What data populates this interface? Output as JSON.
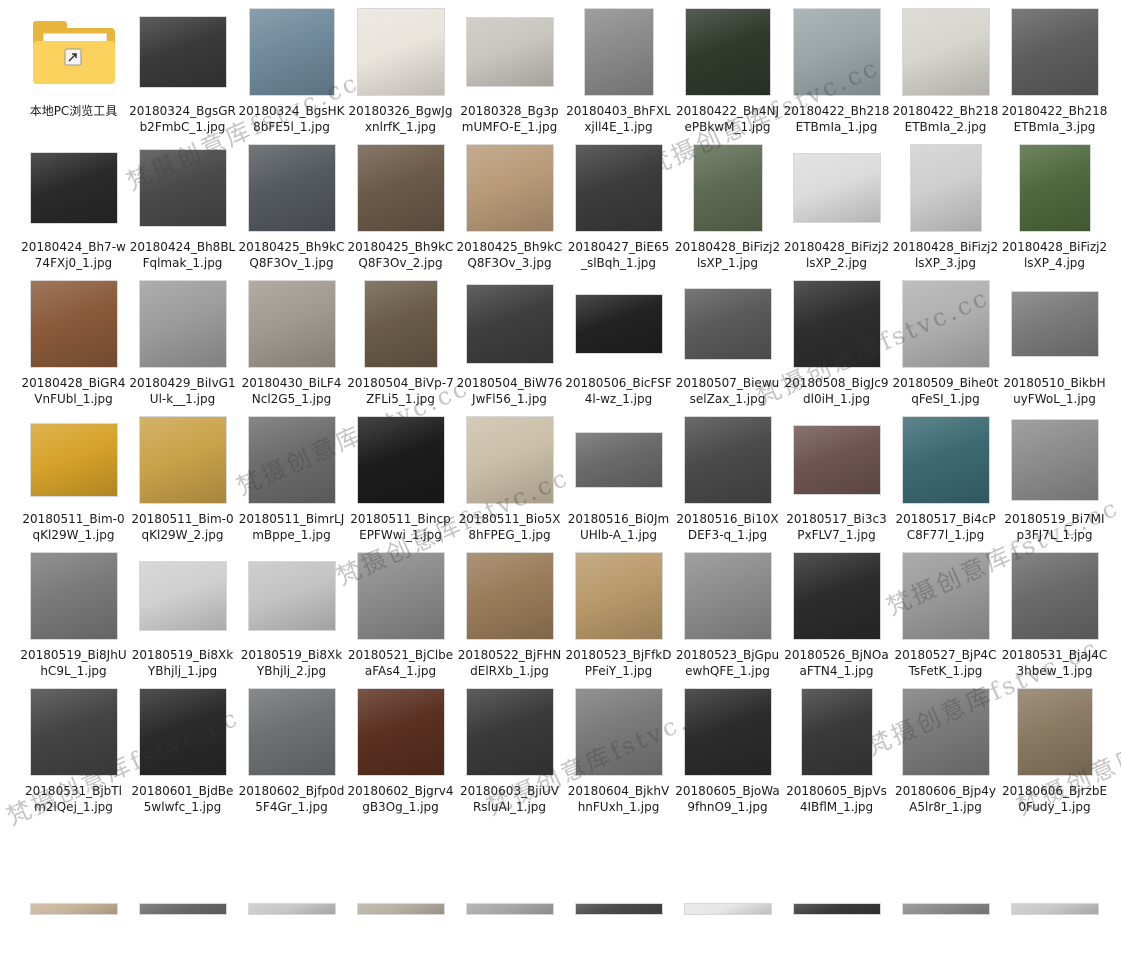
{
  "folder": {
    "label": "本地PC浏览工具",
    "icon": "folder-icon"
  },
  "files": [
    {
      "name": "20180324_BgsGRb2FmbC_1.jpg",
      "tone": "#3a3a3a"
    },
    {
      "name": "20180324_BgsHK8bFE5l_1.jpg",
      "tone": "#6f8a9c"
    },
    {
      "name": "20180326_BgwJgxnlrfK_1.jpg",
      "tone": "#e9e4dc"
    },
    {
      "name": "20180328_Bg3pmUMFO-E_1.jpg",
      "tone": "#c9c5bf"
    },
    {
      "name": "20180403_BhFXLxjll4E_1.jpg",
      "tone": "#8a8a8a"
    },
    {
      "name": "20180422_Bh4NJePBkwM_1.jpg",
      "tone": "#2f3a2c"
    },
    {
      "name": "20180422_Bh218ETBmIa_1.jpg",
      "tone": "#9aa6a8"
    },
    {
      "name": "20180422_Bh218ETBmIa_2.jpg",
      "tone": "#d7d5cf"
    },
    {
      "name": "20180422_Bh218ETBmIa_3.jpg",
      "tone": "#5e5e5e"
    },
    {
      "name": "20180424_Bh7-w74FXj0_1.jpg",
      "tone": "#2a2a2a"
    },
    {
      "name": "20180424_Bh8BLFqlmak_1.jpg",
      "tone": "#4a4a4a"
    },
    {
      "name": "20180425_Bh9kCQ8F3Ov_1.jpg",
      "tone": "#555a60"
    },
    {
      "name": "20180425_Bh9kCQ8F3Ov_2.jpg",
      "tone": "#6b5a48"
    },
    {
      "name": "20180425_Bh9kCQ8F3Ov_3.jpg",
      "tone": "#b89a78"
    },
    {
      "name": "20180427_BiE65_slBqh_1.jpg",
      "tone": "#3c3c3c"
    },
    {
      "name": "20180428_BiFizj2lsXP_1.jpg",
      "tone": "#5e6b52"
    },
    {
      "name": "20180428_BiFizj2lsXP_2.jpg",
      "tone": "#dcdcdc"
    },
    {
      "name": "20180428_BiFizj2lsXP_3.jpg",
      "tone": "#cfcfcf"
    },
    {
      "name": "20180428_BiFizj2lsXP_4.jpg",
      "tone": "#4f6a3e"
    },
    {
      "name": "20180428_BiGR4VnFUbl_1.jpg",
      "tone": "#8a5a3a"
    },
    {
      "name": "20180429_BiIvG1Ul-k__1.jpg",
      "tone": "#9c9c9c"
    },
    {
      "name": "20180430_BiLF4Ncl2G5_1.jpg",
      "tone": "#a09a90"
    },
    {
      "name": "20180504_BiVp-7ZFLi5_1.jpg",
      "tone": "#6a5c48"
    },
    {
      "name": "20180504_BiW76JwFl56_1.jpg",
      "tone": "#3e3e3e"
    },
    {
      "name": "20180506_BicFSF4l-wz_1.jpg",
      "tone": "#222222"
    },
    {
      "name": "20180507_BiewuselZax_1.jpg",
      "tone": "#5a5a5a"
    },
    {
      "name": "20180508_BigJc9dl0iH_1.jpg",
      "tone": "#2e2e2e"
    },
    {
      "name": "20180509_Bihe0tqFeSI_1.jpg",
      "tone": "#b0b0b0"
    },
    {
      "name": "20180510_BikbHuyFWoL_1.jpg",
      "tone": "#7a7a7a"
    },
    {
      "name": "20180511_Bim-0qKl29W_1.jpg",
      "tone": "#d6a32a"
    },
    {
      "name": "20180511_Bim-0qKl29W_2.jpg",
      "tone": "#caa24a"
    },
    {
      "name": "20180511_BimrLJmBppe_1.jpg",
      "tone": "#6c6c6c"
    },
    {
      "name": "20180511_BincpEPFWwi_1.jpg",
      "tone": "#1c1c1c"
    },
    {
      "name": "20180511_Bio5X8hFPEG_1.jpg",
      "tone": "#cbbfa8"
    },
    {
      "name": "20180516_Bi0JmUHlb-A_1.jpg",
      "tone": "#6a6a6a"
    },
    {
      "name": "20180516_Bi10XDEF3-q_1.jpg",
      "tone": "#4a4a4a"
    },
    {
      "name": "20180517_Bi3c3PxFLV7_1.jpg",
      "tone": "#6e5450"
    },
    {
      "name": "20180517_Bi4cPC8F77l_1.jpg",
      "tone": "#3c6a72"
    },
    {
      "name": "20180519_Bi7MIp3FJ7L_1.jpg",
      "tone": "#8c8c8c"
    },
    {
      "name": "20180519_Bi8JhUhC9L_1.jpg",
      "tone": "#7a7a7a"
    },
    {
      "name": "20180519_Bi8XkYBhjlj_1.jpg",
      "tone": "#d0d0d0"
    },
    {
      "name": "20180519_Bi8XkYBhjlj_2.jpg",
      "tone": "#c4c4c4"
    },
    {
      "name": "20180521_BjClbeaFAs4_1.jpg",
      "tone": "#8a8a8a"
    },
    {
      "name": "20180522_BjFHNdElRXb_1.jpg",
      "tone": "#9a7c5a"
    },
    {
      "name": "20180523_BjFfkDPFeiY_1.jpg",
      "tone": "#b99a6a"
    },
    {
      "name": "20180523_BjGpuewhQFE_1.jpg",
      "tone": "#8c8c8c"
    },
    {
      "name": "20180526_BjNOaaFTN4_1.jpg",
      "tone": "#2c2c2c"
    },
    {
      "name": "20180527_BjP4CTsFetK_1.jpg",
      "tone": "#9a9a9a"
    },
    {
      "name": "20180531_BjaJ4C3hbew_1.jpg",
      "tone": "#6a6a6a"
    },
    {
      "name": "20180531_BjbTlm2lQej_1.jpg",
      "tone": "#444444"
    },
    {
      "name": "20180601_BjdBe5wlwfc_1.jpg",
      "tone": "#2a2a2a"
    },
    {
      "name": "20180602_Bjfp0d5F4Gr_1.jpg",
      "tone": "#6e7072"
    },
    {
      "name": "20180602_Bjgrv4gB3Og_1.jpg",
      "tone": "#5a3020"
    },
    {
      "name": "20180603_BjiUVRsluAl_1.jpg",
      "tone": "#3a3a3a"
    },
    {
      "name": "20180604_BjkhVhnFUxh_1.jpg",
      "tone": "#7a7a7a"
    },
    {
      "name": "20180605_BjoWa9fhnO9_1.jpg",
      "tone": "#2c2c2c"
    },
    {
      "name": "20180605_BjpVs4IBflM_1.jpg",
      "tone": "#3a3a3a"
    },
    {
      "name": "20180606_Bjp4yA5lr8r_1.jpg",
      "tone": "#7a7a7a"
    },
    {
      "name": "20180606_BjrzbE0Fudy_1.jpg",
      "tone": "#8a7a62"
    },
    {
      "name": "",
      "tone": "#c9b59a"
    },
    {
      "name": "",
      "tone": "#6a6a6a"
    },
    {
      "name": "",
      "tone": "#c8c8c8"
    },
    {
      "name": "",
      "tone": "#b8b0a4"
    },
    {
      "name": "",
      "tone": "#a8a8a8"
    },
    {
      "name": "",
      "tone": "#4a4a4a"
    },
    {
      "name": "",
      "tone": "#e6e6e6"
    },
    {
      "name": "",
      "tone": "#3a3a3a"
    },
    {
      "name": "",
      "tone": "#8a8a8a"
    },
    {
      "name": "",
      "tone": "#c9c9c9"
    }
  ],
  "watermark": {
    "text": "梵摄创意库fstvc.cc",
    "color": "rgba(60,60,60,0.30)"
  }
}
